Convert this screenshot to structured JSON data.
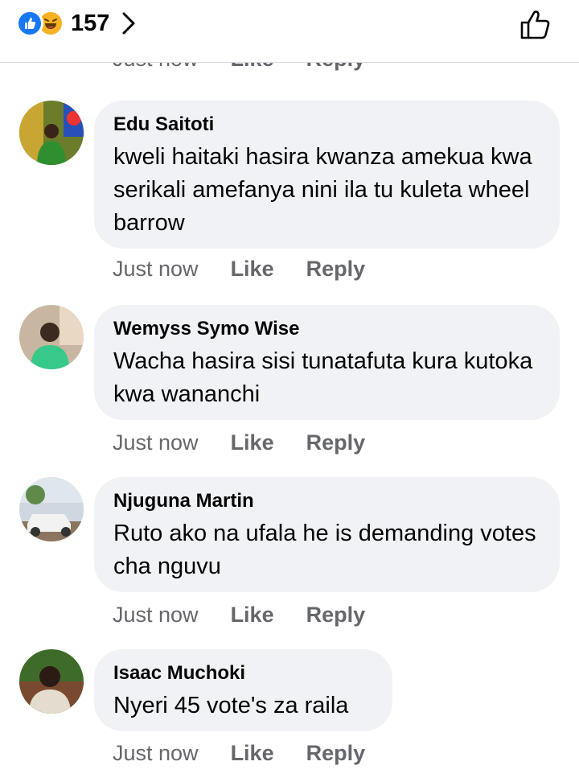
{
  "header": {
    "reaction_count": "157",
    "reactions": [
      "like-icon",
      "haha-icon"
    ]
  },
  "prev_actions": {
    "time": "Just now",
    "like": "Like",
    "reply": "Reply"
  },
  "comments": [
    {
      "author": "Edu Saitoti",
      "text": "kweli haitaki hasira kwanza amekua kwa serikali amefanya nini ila tu kuleta wheel barrow",
      "time": "Just now",
      "like": "Like",
      "reply": "Reply"
    },
    {
      "author": "Wemyss Symo Wise",
      "text": "Wacha hasira sisi tunatafuta kura kutoka kwa wananchi",
      "time": "Just now",
      "like": "Like",
      "reply": "Reply"
    },
    {
      "author": "Njuguna Martin",
      "text": "Ruto ako na ufala he is demanding votes cha nguvu",
      "time": "Just now",
      "like": "Like",
      "reply": "Reply"
    },
    {
      "author": "Isaac Muchoki",
      "text": "Nyeri 45 vote's za raila",
      "time": "Just now",
      "like": "Like",
      "reply": "Reply"
    }
  ],
  "colors": {
    "like_blue": "#1877f2",
    "haha_yellow": "#f7b125",
    "bubble_bg": "#f0f2f5",
    "meta_gray": "#65676b"
  }
}
